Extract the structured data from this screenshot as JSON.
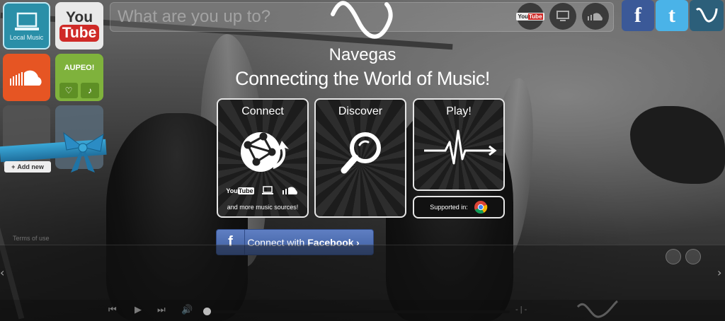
{
  "search": {
    "placeholder": "What are you up to?"
  },
  "left_tiles": {
    "local_music": {
      "label": "Local Music"
    },
    "youtube": {
      "word1": "You",
      "word2": "Tube"
    },
    "aupeo": {
      "label": "AUPEO!"
    },
    "add_new": {
      "label": "Add new"
    }
  },
  "header_sources": [
    "youtube-icon",
    "screen-icon",
    "soundcloud-icon"
  ],
  "social": {
    "facebook": "f",
    "twitter": "t"
  },
  "brand": {
    "name": "Navegas",
    "tagline": "Connecting the World of Music!"
  },
  "cards": {
    "connect": {
      "title": "Connect",
      "sources_text": "and more music sources!",
      "youtube_label": "YouTube"
    },
    "discover": {
      "title": "Discover"
    },
    "play": {
      "title": "Play!"
    },
    "supported": {
      "label": "Supported in:"
    }
  },
  "facebook_button": {
    "icon": "f",
    "prefix": "Connect",
    "middle": " with ",
    "brand": "Facebook",
    "chevron": "›"
  },
  "footer": {
    "terms": "Terms of use",
    "time": "- | -"
  },
  "colors": {
    "facebook": "#3e5d9f",
    "soundcloud": "#e65523",
    "aupeo": "#7fb23c",
    "local_music": "#2a8fa8",
    "youtube_red": "#cf2a27"
  }
}
